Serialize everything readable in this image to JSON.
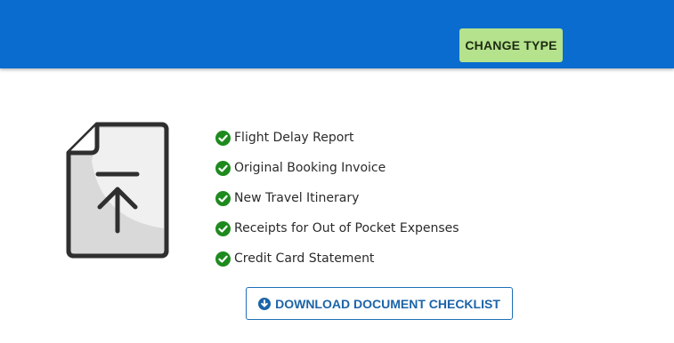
{
  "header": {
    "change_type_label": "CHANGE TYPE"
  },
  "illustration": {
    "icon": "document-upload-icon"
  },
  "checklist": [
    {
      "label": "Flight Delay Report",
      "icon": "check-circle-icon"
    },
    {
      "label": "Original Booking Invoice",
      "icon": "check-circle-icon"
    },
    {
      "label": "New Travel Itinerary",
      "icon": "check-circle-icon"
    },
    {
      "label": "Receipts for Out of Pocket Expenses",
      "icon": "check-circle-icon"
    },
    {
      "label": "Credit Card Statement",
      "icon": "check-circle-icon"
    }
  ],
  "download": {
    "label": "DOWNLOAD DOCUMENT CHECKLIST",
    "icon": "download-circle-icon"
  },
  "colors": {
    "header_bg": "#0a6ccf",
    "change_type_bg": "#b5e28c",
    "check_green": "#1e8a1e",
    "download_blue": "#1c64a8"
  }
}
